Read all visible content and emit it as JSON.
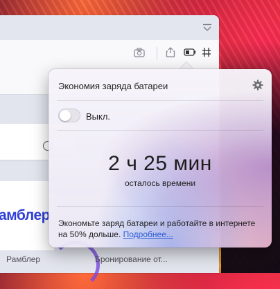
{
  "battery_popover": {
    "title": "Экономия заряда батареи",
    "toggle_label": "Выкл.",
    "toggle_state": "off",
    "time_remaining": "2 ч 25 мин",
    "time_caption": "осталось времени",
    "promo_text": "Экономьте заряд батареи и работайте в интернете на 50% дольше.",
    "more_link": "Подробнее..."
  },
  "page": {
    "logo_text": "амблер",
    "tiles": [
      {
        "label": "Рамблер"
      },
      {
        "label": "Бронирование от..."
      }
    ]
  },
  "toolbar": {
    "icons": [
      "camera-icon",
      "share-icon",
      "battery-icon",
      "settings-sliders-icon",
      "tabs-menu-icon"
    ]
  },
  "colors": {
    "link": "#2a5bd7",
    "logo": "#2f3fd8",
    "accent_arc": "#7a4ae0"
  }
}
